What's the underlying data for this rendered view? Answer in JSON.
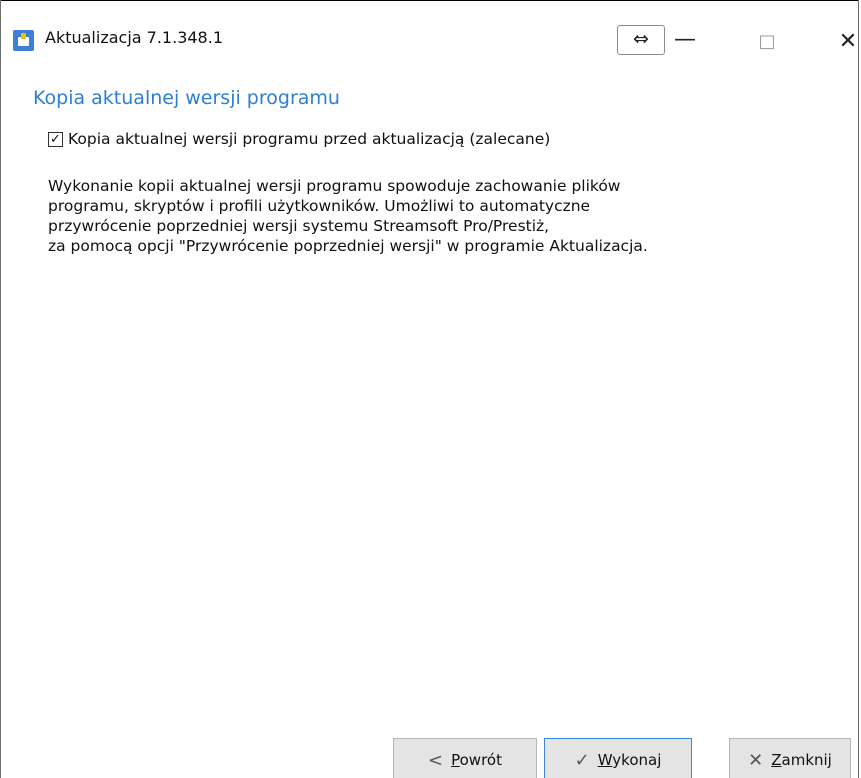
{
  "window": {
    "title": "Aktualizacja 7.1.348.1",
    "controls": {
      "resize": "⇔",
      "minimize": "—",
      "maximize": "□",
      "close": "✕"
    }
  },
  "page": {
    "heading": "Kopia aktualnej wersji programu",
    "checkbox": {
      "label": "Kopia aktualnej wersji programu przed aktualizacją (zalecane)",
      "checked": true,
      "mark": "✓"
    },
    "description_lines": [
      "Wykonanie kopii aktualnej wersji programu spowoduje zachowanie plików",
      "programu, skryptów i profili użytkowników. Umożliwi to automatyczne",
      "przywrócenie poprzedniej wersji systemu Streamsoft Pro/Prestiż,",
      "za pomocą opcji \"Przywrócenie poprzedniej wersji\" w programie Aktualizacja."
    ]
  },
  "buttons": {
    "back": {
      "glyph": "<",
      "mnemonic": "P",
      "rest": "owrót"
    },
    "run": {
      "glyph": "✓",
      "mnemonic": "W",
      "rest": "ykonaj"
    },
    "close": {
      "glyph": "✕",
      "mnemonic": "Z",
      "rest": "amknij"
    }
  },
  "colors": {
    "heading": "#2d7fd3",
    "icon": "#3f7fd6",
    "default_button_border": "#3c85d8"
  }
}
